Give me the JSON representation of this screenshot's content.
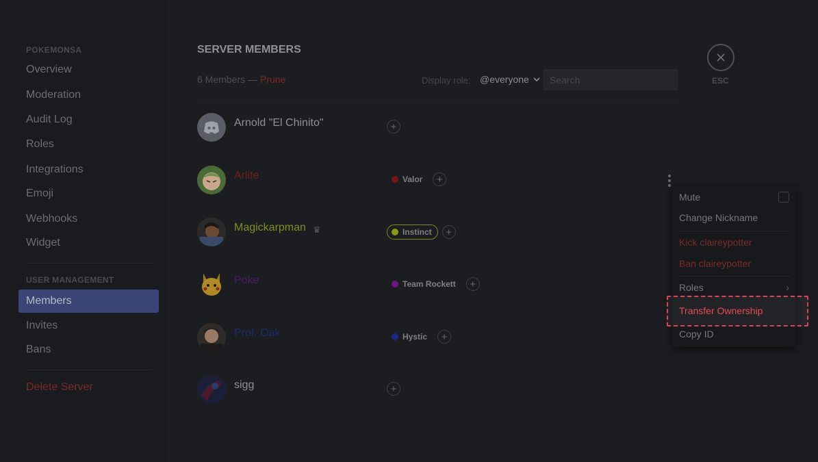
{
  "sidebar": {
    "server_header": "POKEMONSA",
    "items": [
      {
        "label": "Overview"
      },
      {
        "label": "Moderation"
      },
      {
        "label": "Audit Log"
      },
      {
        "label": "Roles"
      },
      {
        "label": "Integrations"
      },
      {
        "label": "Emoji"
      },
      {
        "label": "Webhooks"
      },
      {
        "label": "Widget"
      }
    ],
    "user_mgmt_header": "USER MANAGEMENT",
    "user_items": [
      {
        "label": "Members",
        "active": true
      },
      {
        "label": "Invites"
      },
      {
        "label": "Bans"
      }
    ],
    "delete_label": "Delete Server"
  },
  "main": {
    "title": "SERVER MEMBERS",
    "member_count": "6 Members",
    "dash": "—",
    "prune_label": "Prune",
    "display_role_label": "Display role:",
    "display_role_value": "@everyone",
    "search_placeholder": "Search"
  },
  "close": {
    "esc_label": "ESC",
    "icon": "close-icon"
  },
  "members": [
    {
      "name": "Arnold \"El Chinito\"",
      "color": "#8e9096",
      "roles": [],
      "avatar": "discord-logo"
    },
    {
      "name": "Arlite",
      "color": "#6b1f1f",
      "roles": [
        {
          "label": "Valor",
          "color": "#7a1515"
        }
      ],
      "avatar": "cartoon"
    },
    {
      "name": "Magickarpman",
      "color": "#7f8f1e",
      "owner": true,
      "roles": [
        {
          "label": "Instinct",
          "color": "#8a9a10",
          "outlined": true
        }
      ],
      "avatar": "photo"
    },
    {
      "name": "Poke",
      "color": "#4d1a6b",
      "roles": [
        {
          "label": "Team Rockett",
          "color": "#6d1580"
        }
      ],
      "avatar": "pikachu"
    },
    {
      "name": "Prof. Oak",
      "color": "#1c2a6b",
      "roles": [
        {
          "label": "Hystic",
          "color": "#172a85"
        }
      ],
      "avatar": "photo"
    },
    {
      "name": "sigg",
      "color": "#8e9096",
      "roles": [],
      "avatar": "spider"
    }
  ],
  "context_menu": {
    "items": [
      {
        "label": "Mute",
        "type": "checkbox"
      },
      {
        "label": "Change Nickname"
      },
      {
        "label": "Kick claireypotter",
        "danger": true
      },
      {
        "label": "Ban claireypotter",
        "danger": true
      },
      {
        "label": "Roles",
        "submenu": true
      },
      {
        "label": "Transfer Ownership",
        "highlighted": true
      },
      {
        "label": "Copy ID"
      }
    ]
  },
  "colors": {
    "accent": "#3a4577",
    "danger": "#e8434b",
    "highlight_border": "#e04352"
  }
}
